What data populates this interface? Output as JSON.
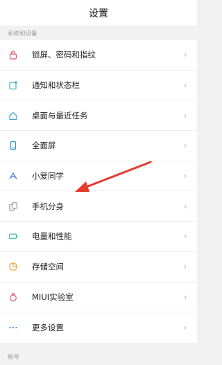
{
  "header": {
    "title": "设置"
  },
  "section1": {
    "label": "系统和设备"
  },
  "items": [
    {
      "label": "锁屏、密码和指纹",
      "icon": "lock-icon",
      "color": "#e0566b"
    },
    {
      "label": "通知和状态栏",
      "icon": "notification-icon",
      "color": "#2fb7b0"
    },
    {
      "label": "桌面与最近任务",
      "icon": "home-icon",
      "color": "#3aa6d8"
    },
    {
      "label": "全面屏",
      "icon": "phone-icon",
      "color": "#2c8ee0"
    },
    {
      "label": "小爱同学",
      "icon": "xiaoai-icon",
      "color": "#4a7de0"
    },
    {
      "label": "手机分身",
      "icon": "dual-space-icon",
      "color": "#8a8fa0"
    },
    {
      "label": "电量和性能",
      "icon": "battery-icon",
      "color": "#3ec49a"
    },
    {
      "label": "存储空间",
      "icon": "storage-icon",
      "color": "#f0a030"
    },
    {
      "label": "MIUI实验室",
      "icon": "lab-icon",
      "color": "#e0566b"
    },
    {
      "label": "更多设置",
      "icon": "more-icon",
      "color": "#3a8fe0"
    }
  ],
  "section2": {
    "label": "帐号"
  },
  "annotation": {
    "color": "#e53a2e"
  }
}
